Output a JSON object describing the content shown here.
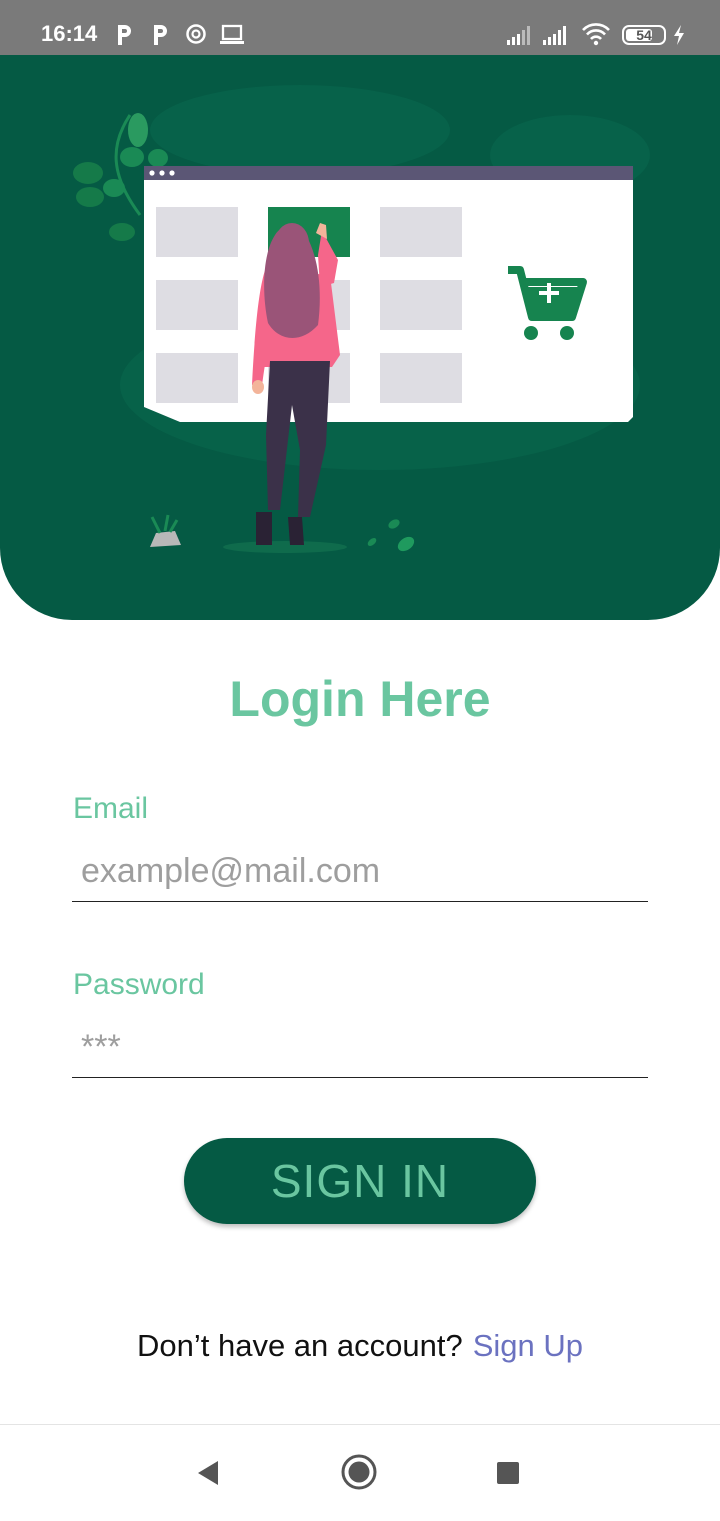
{
  "status_bar": {
    "time": "16:14",
    "notification_icons": [
      "p-icon",
      "p-icon",
      "shield-icon",
      "laptop-icon"
    ],
    "battery": "54"
  },
  "login": {
    "title": "Login Here",
    "email_label": "Email",
    "email_placeholder": "example@mail.com",
    "password_label": "Password",
    "password_placeholder": "***",
    "signin_label": "SIGN IN",
    "signup_prompt": "Don’t have an account?",
    "signup_link": "Sign Up"
  },
  "colors": {
    "primary_dark": "#055a44",
    "accent_green": "#6ac6a0",
    "link": "#6b72c0"
  }
}
